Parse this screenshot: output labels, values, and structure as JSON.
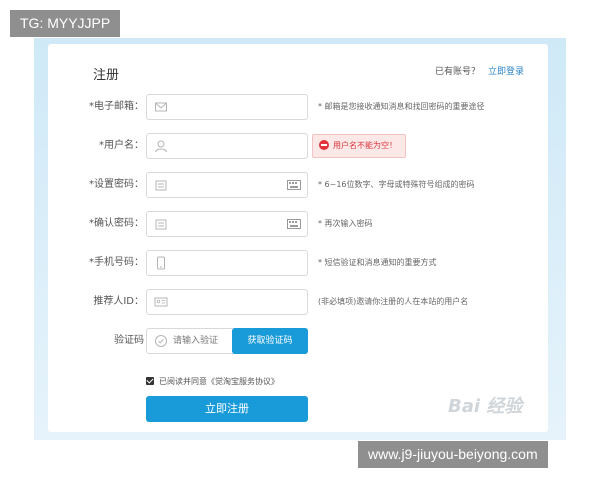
{
  "overlay": {
    "top_tag": "TG: MYYJJPP",
    "bottom_tag": "www.j9-jiuyou-beiyong.com"
  },
  "form": {
    "title": "注册",
    "login_prompt": "已有账号？",
    "login_link": "立即登录",
    "fields": [
      {
        "label": "*电子邮箱：",
        "icon": "mail-icon",
        "hint": "* 邮箱是您接收通知消息和找回密码的重要途径"
      },
      {
        "label": "*用户名：",
        "icon": "user-icon",
        "error": "用户名不能为空！"
      },
      {
        "label": "*设置密码：",
        "icon": "lock-icon",
        "hint": "* 6~16位数字、字母或特殊符号组成的密码"
      },
      {
        "label": "*确认密码：",
        "icon": "lock-icon",
        "hint": "* 再次输入密码"
      },
      {
        "label": "*手机号码：",
        "icon": "phone-icon",
        "hint": "* 短信验证和消息通知的重要方式"
      },
      {
        "label": "推荐人ID：",
        "icon": "id-card-icon",
        "hint": "(非必填项)邀请你注册的人在本站的用户名"
      }
    ],
    "captcha": {
      "label": "验证码",
      "placeholder": "请输入验证",
      "button": "获取验证码"
    },
    "agreement": {
      "text": "已阅读并同意《觉淘宝服务协议》",
      "checked": true
    },
    "submit": "立即注册"
  },
  "watermark": "Bai 经验",
  "colors": {
    "accent": "#1a9bd9",
    "link": "#2f86c8",
    "error": "#d9363e",
    "background": "#cfe9f7"
  }
}
